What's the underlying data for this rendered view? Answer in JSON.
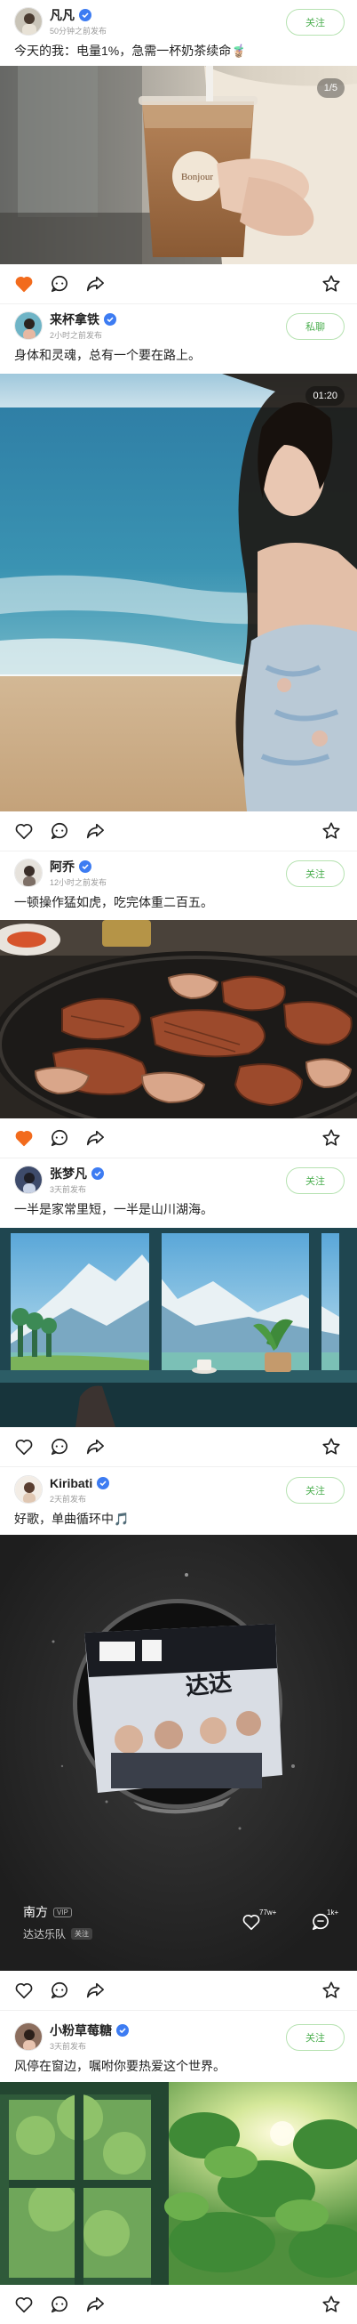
{
  "posts": [
    {
      "username": "凡凡",
      "time": "50分钟之前发布",
      "follow_label": "关注",
      "caption": "今天的我：电量1%，急需一杯奶茶续命🧋",
      "badge": "1/5",
      "cup_text": "Bonjour",
      "liked": true
    },
    {
      "username": "来杯拿铁",
      "time": "2小时之前发布",
      "follow_label": "私聊",
      "caption": "身体和灵魂，总有一个要在路上。",
      "badge": "01:20",
      "liked": false
    },
    {
      "username": "阿乔",
      "time": "12小时之前发布",
      "follow_label": "关注",
      "caption": "一顿操作猛如虎，吃完体重二百五。",
      "liked": true
    },
    {
      "username": "张梦凡",
      "time": "3天前发布",
      "follow_label": "关注",
      "caption": "一半是家常里短，一半是山川湖海。",
      "liked": false
    },
    {
      "username": "Kiribati",
      "time": "2天前发布",
      "follow_label": "关注",
      "caption": "好歌，单曲循环中🎵",
      "liked": false,
      "music": {
        "song": "南方",
        "vip_label": "VIP",
        "artist": "达达乐队",
        "artist_follow": "关注",
        "likes": "77w+",
        "comments": "1k+"
      }
    },
    {
      "username": "小粉草莓糖",
      "time": "3天前发布",
      "follow_label": "关注",
      "caption": "风停在窗边，嘱咐你要热爱这个世界。",
      "liked": false
    }
  ],
  "icons": {
    "like": "heart-icon",
    "comment": "comment-icon",
    "share": "share-icon",
    "favorite": "star-icon"
  },
  "colors": {
    "liked": "#f26b1d",
    "follow_text": "#4caf50",
    "follow_border": "#b6e2b1",
    "verified": "#3d7cf2"
  }
}
